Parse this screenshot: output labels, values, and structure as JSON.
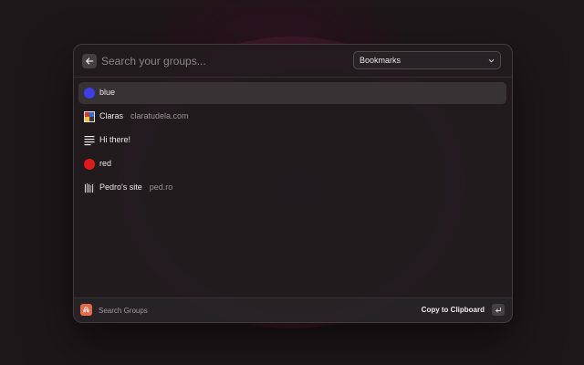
{
  "search": {
    "placeholder": "Search your groups..."
  },
  "dropdown": {
    "selected": "Bookmarks"
  },
  "items": [
    {
      "title": "blue",
      "subtitle": "",
      "icon": "blue-dot-icon",
      "color": "#3b3fe6"
    },
    {
      "title": "Claras",
      "subtitle": "claratudela.com",
      "icon": "favicon-claras",
      "color": ""
    },
    {
      "title": "Hi there!",
      "subtitle": "",
      "icon": "text-lines-icon",
      "color": "#e8e4e5"
    },
    {
      "title": "red",
      "subtitle": "",
      "icon": "red-dot-icon",
      "color": "#e0191b"
    },
    {
      "title": "Pedro's site",
      "subtitle": "ped.ro",
      "icon": "favicon-pedro",
      "color": ""
    }
  ],
  "footer": {
    "label": "Search Groups",
    "action": "Copy to Clipboard"
  }
}
